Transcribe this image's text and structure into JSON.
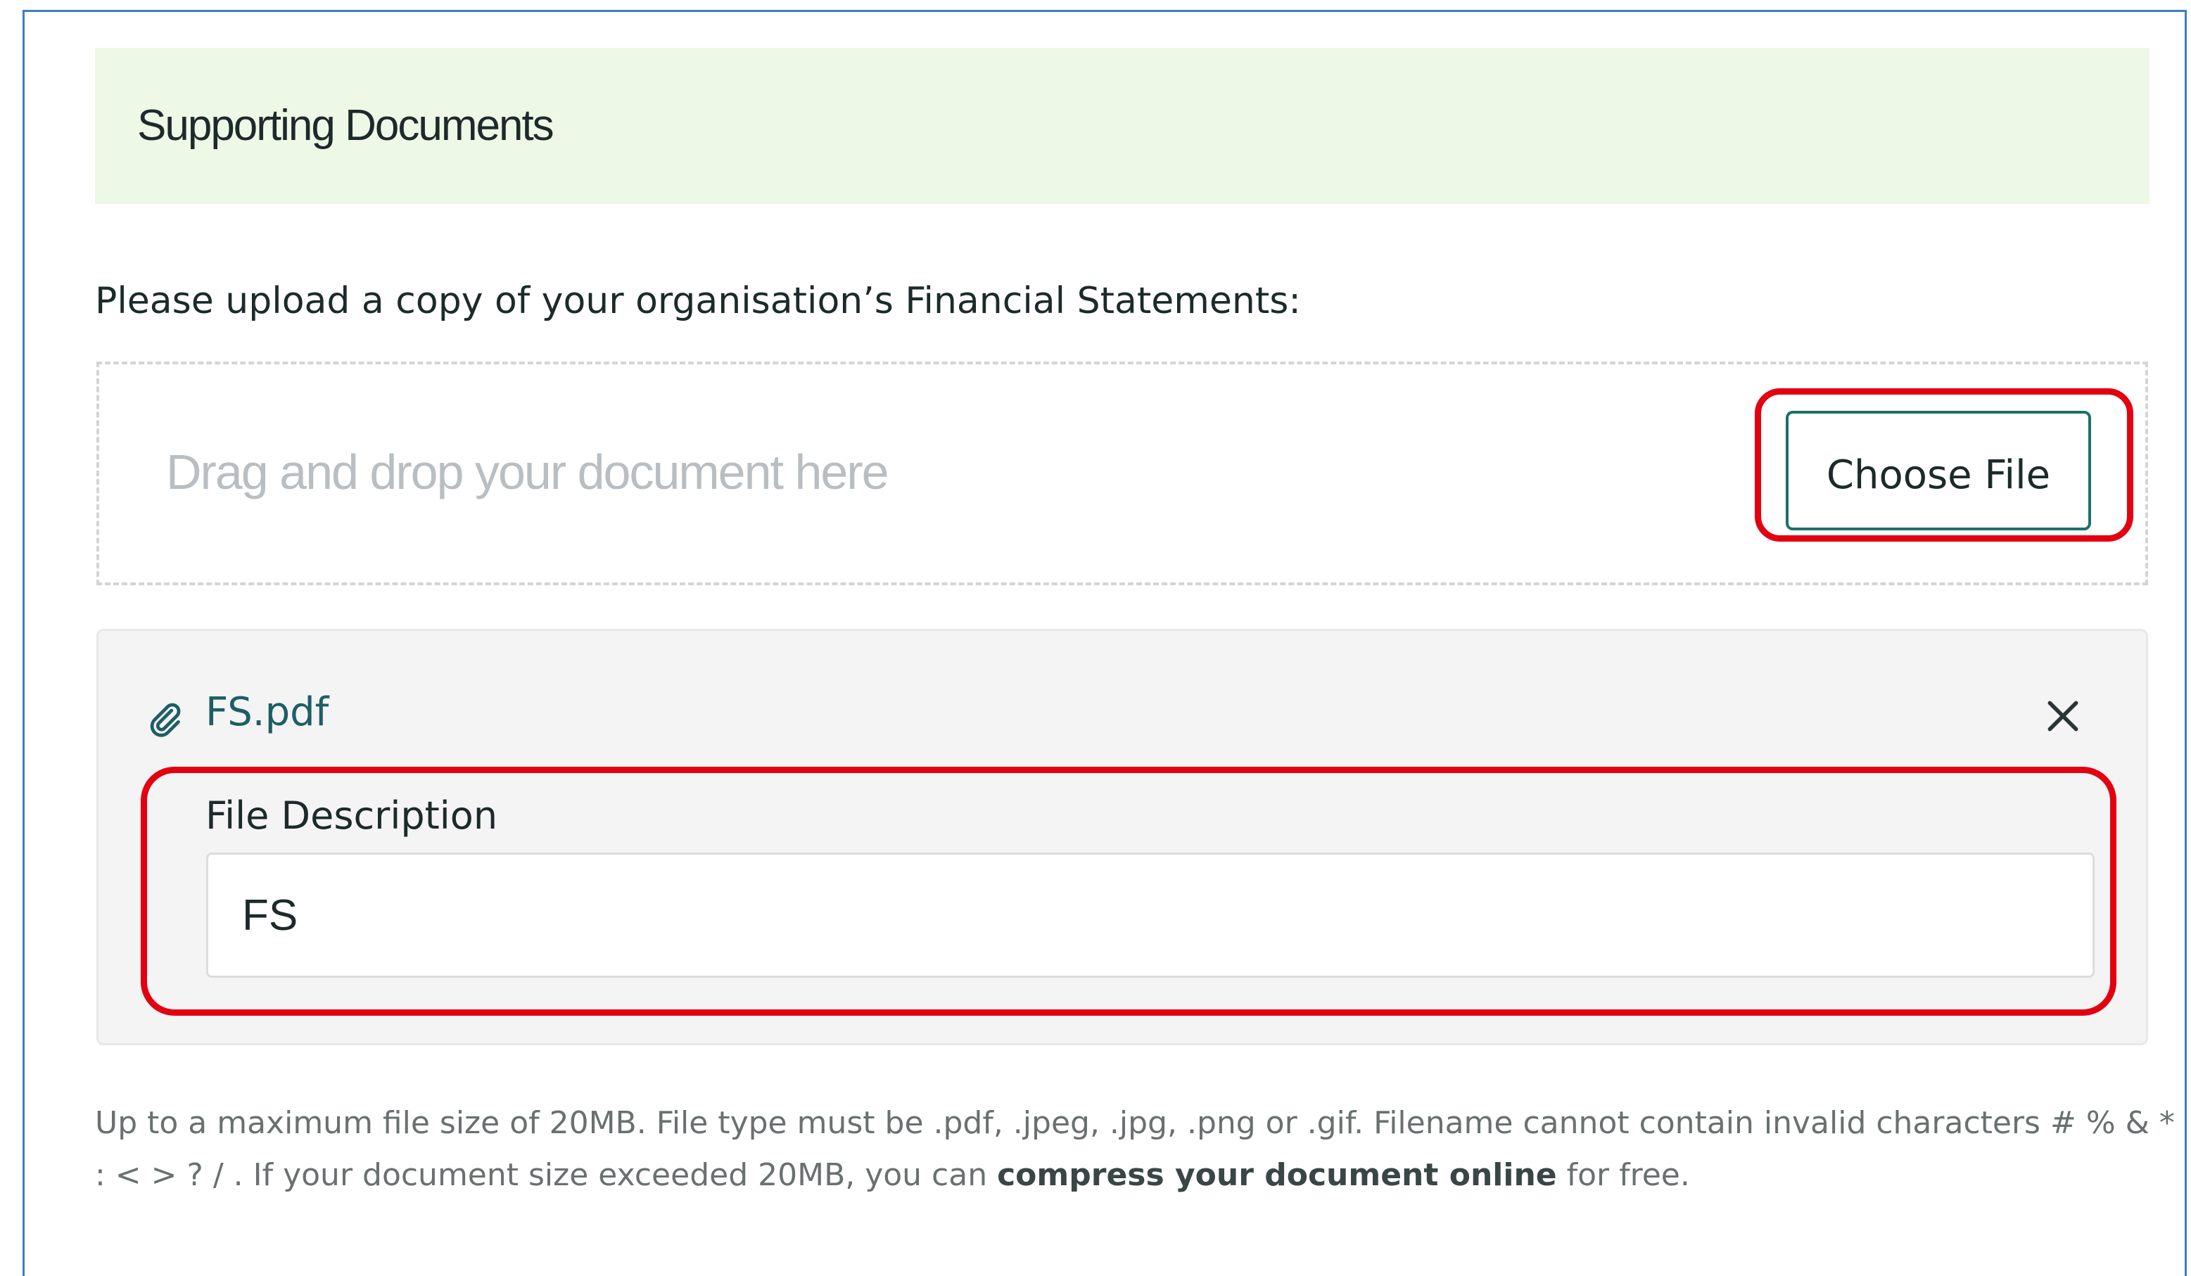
{
  "section": {
    "title": "Supporting Documents"
  },
  "question": {
    "text": "Please upload a copy of your organisation’s Financial Statements:"
  },
  "dropzone": {
    "placeholder": "Drag and drop your document here",
    "choose_button": "Choose File"
  },
  "uploaded_file": {
    "name": "FS.pdf",
    "attachment_icon": "paperclip-icon",
    "remove_icon": "close-icon",
    "description_label": "File Description",
    "description_value": "FS"
  },
  "help": {
    "line1": "Up to a maximum file size of 20MB. File type must be .pdf, .jpeg, .jpg, .png or .gif. Filename cannot contain invalid characters # % & * : < > ? / . If your document size exceeded 20MB, you can",
    "link": "compress your document online",
    "suffix": "for free."
  },
  "colors": {
    "header_bg": "#eef8e6",
    "accent_teal": "#1d6f6a",
    "highlight_red": "#e3000f",
    "frame_blue": "#3b7fc4"
  }
}
